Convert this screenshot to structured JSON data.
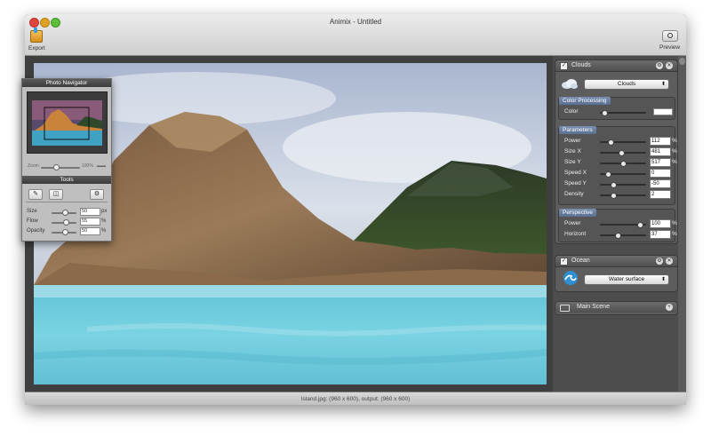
{
  "window": {
    "title": "Animix - Untitled"
  },
  "toolbar": {
    "export_label": "Export",
    "preview_label": "Preview",
    "export_icon": "export-icon",
    "preview_icon": "eye-icon"
  },
  "status": {
    "text": "Island.jpg: (960 x 600), output: (960 x 600)"
  },
  "navigator": {
    "title": "Photo Navigator",
    "zoom_min": "Zoom",
    "zoom_max": "100%",
    "zoom_level": 0.35
  },
  "tools": {
    "title": "Tools",
    "buttons": [
      "brush-icon",
      "eraser-icon",
      "gear-icon"
    ],
    "rows": [
      {
        "label": "Size",
        "value": "50",
        "unit": "px",
        "level": 0.5
      },
      {
        "label": "Flow",
        "value": "55",
        "unit": "%",
        "level": 0.55
      },
      {
        "label": "Opacity",
        "value": "50",
        "unit": "%",
        "level": 0.5
      }
    ]
  },
  "inspector": {
    "clouds": {
      "title": "Clouds",
      "checked": true,
      "type_value": "Clouds",
      "color_processing": {
        "title": "Color Processing",
        "color_label": "Color"
      },
      "parameters": {
        "title": "Parameters",
        "rows": [
          {
            "label": "Power",
            "value": "112",
            "unit": "%",
            "level": 0.2
          },
          {
            "label": "Size X",
            "value": "481",
            "unit": "%",
            "level": 0.45
          },
          {
            "label": "Size Y",
            "value": "517",
            "unit": "%",
            "level": 0.48
          },
          {
            "label": "Speed X",
            "value": "0",
            "unit": "",
            "level": 0.12
          },
          {
            "label": "Speed Y",
            "value": "-50",
            "unit": "",
            "level": 0.25
          },
          {
            "label": "Density",
            "value": "2",
            "unit": "",
            "level": 0.25
          }
        ]
      },
      "perspective": {
        "title": "Perspective",
        "rows": [
          {
            "label": "Power",
            "value": "100",
            "unit": "%",
            "level": 0.9
          },
          {
            "label": "Horizont",
            "value": "37",
            "unit": "%",
            "level": 0.37
          }
        ]
      }
    },
    "ocean": {
      "title": "Ocean",
      "checked": true,
      "type_value": "Water surface"
    },
    "main_scene": {
      "title": "Main Scene"
    }
  }
}
